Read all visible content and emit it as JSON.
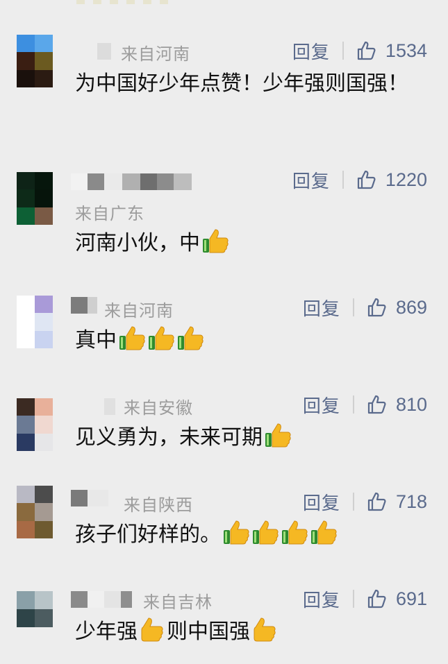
{
  "comments": [
    {
      "location": "来自河南",
      "reply_label": "回复",
      "likes": "1534",
      "text": "为中国好少年点赞！少年强则国强！",
      "thumbs": 0,
      "after_thumbs": ""
    },
    {
      "location": "来自广东",
      "reply_label": "回复",
      "likes": "1220",
      "text": "河南小伙，中",
      "thumbs": 1,
      "after_thumbs": ""
    },
    {
      "location": "来自河南",
      "reply_label": "回复",
      "likes": "869",
      "text": "真中",
      "thumbs": 3,
      "after_thumbs": ""
    },
    {
      "location": "来自安徽",
      "reply_label": "回复",
      "likes": "810",
      "text": "见义勇为，未来可期",
      "thumbs": 1,
      "after_thumbs": ""
    },
    {
      "location": "来自陕西",
      "reply_label": "回复",
      "likes": "718",
      "text": "孩子们好样的。",
      "thumbs": 4,
      "after_thumbs": ""
    },
    {
      "location": "来自吉林",
      "reply_label": "回复",
      "likes": "691",
      "text": "少年强",
      "thumbs": 1,
      "after_thumbs": "则中国强"
    }
  ],
  "icons": {
    "like": "thumbs-up-outline-icon",
    "emoji": "thumbs-up-emoji-icon"
  },
  "colors": {
    "link": "#5a6a8c",
    "meta": "#9c9c9c",
    "background": "#ededed"
  }
}
